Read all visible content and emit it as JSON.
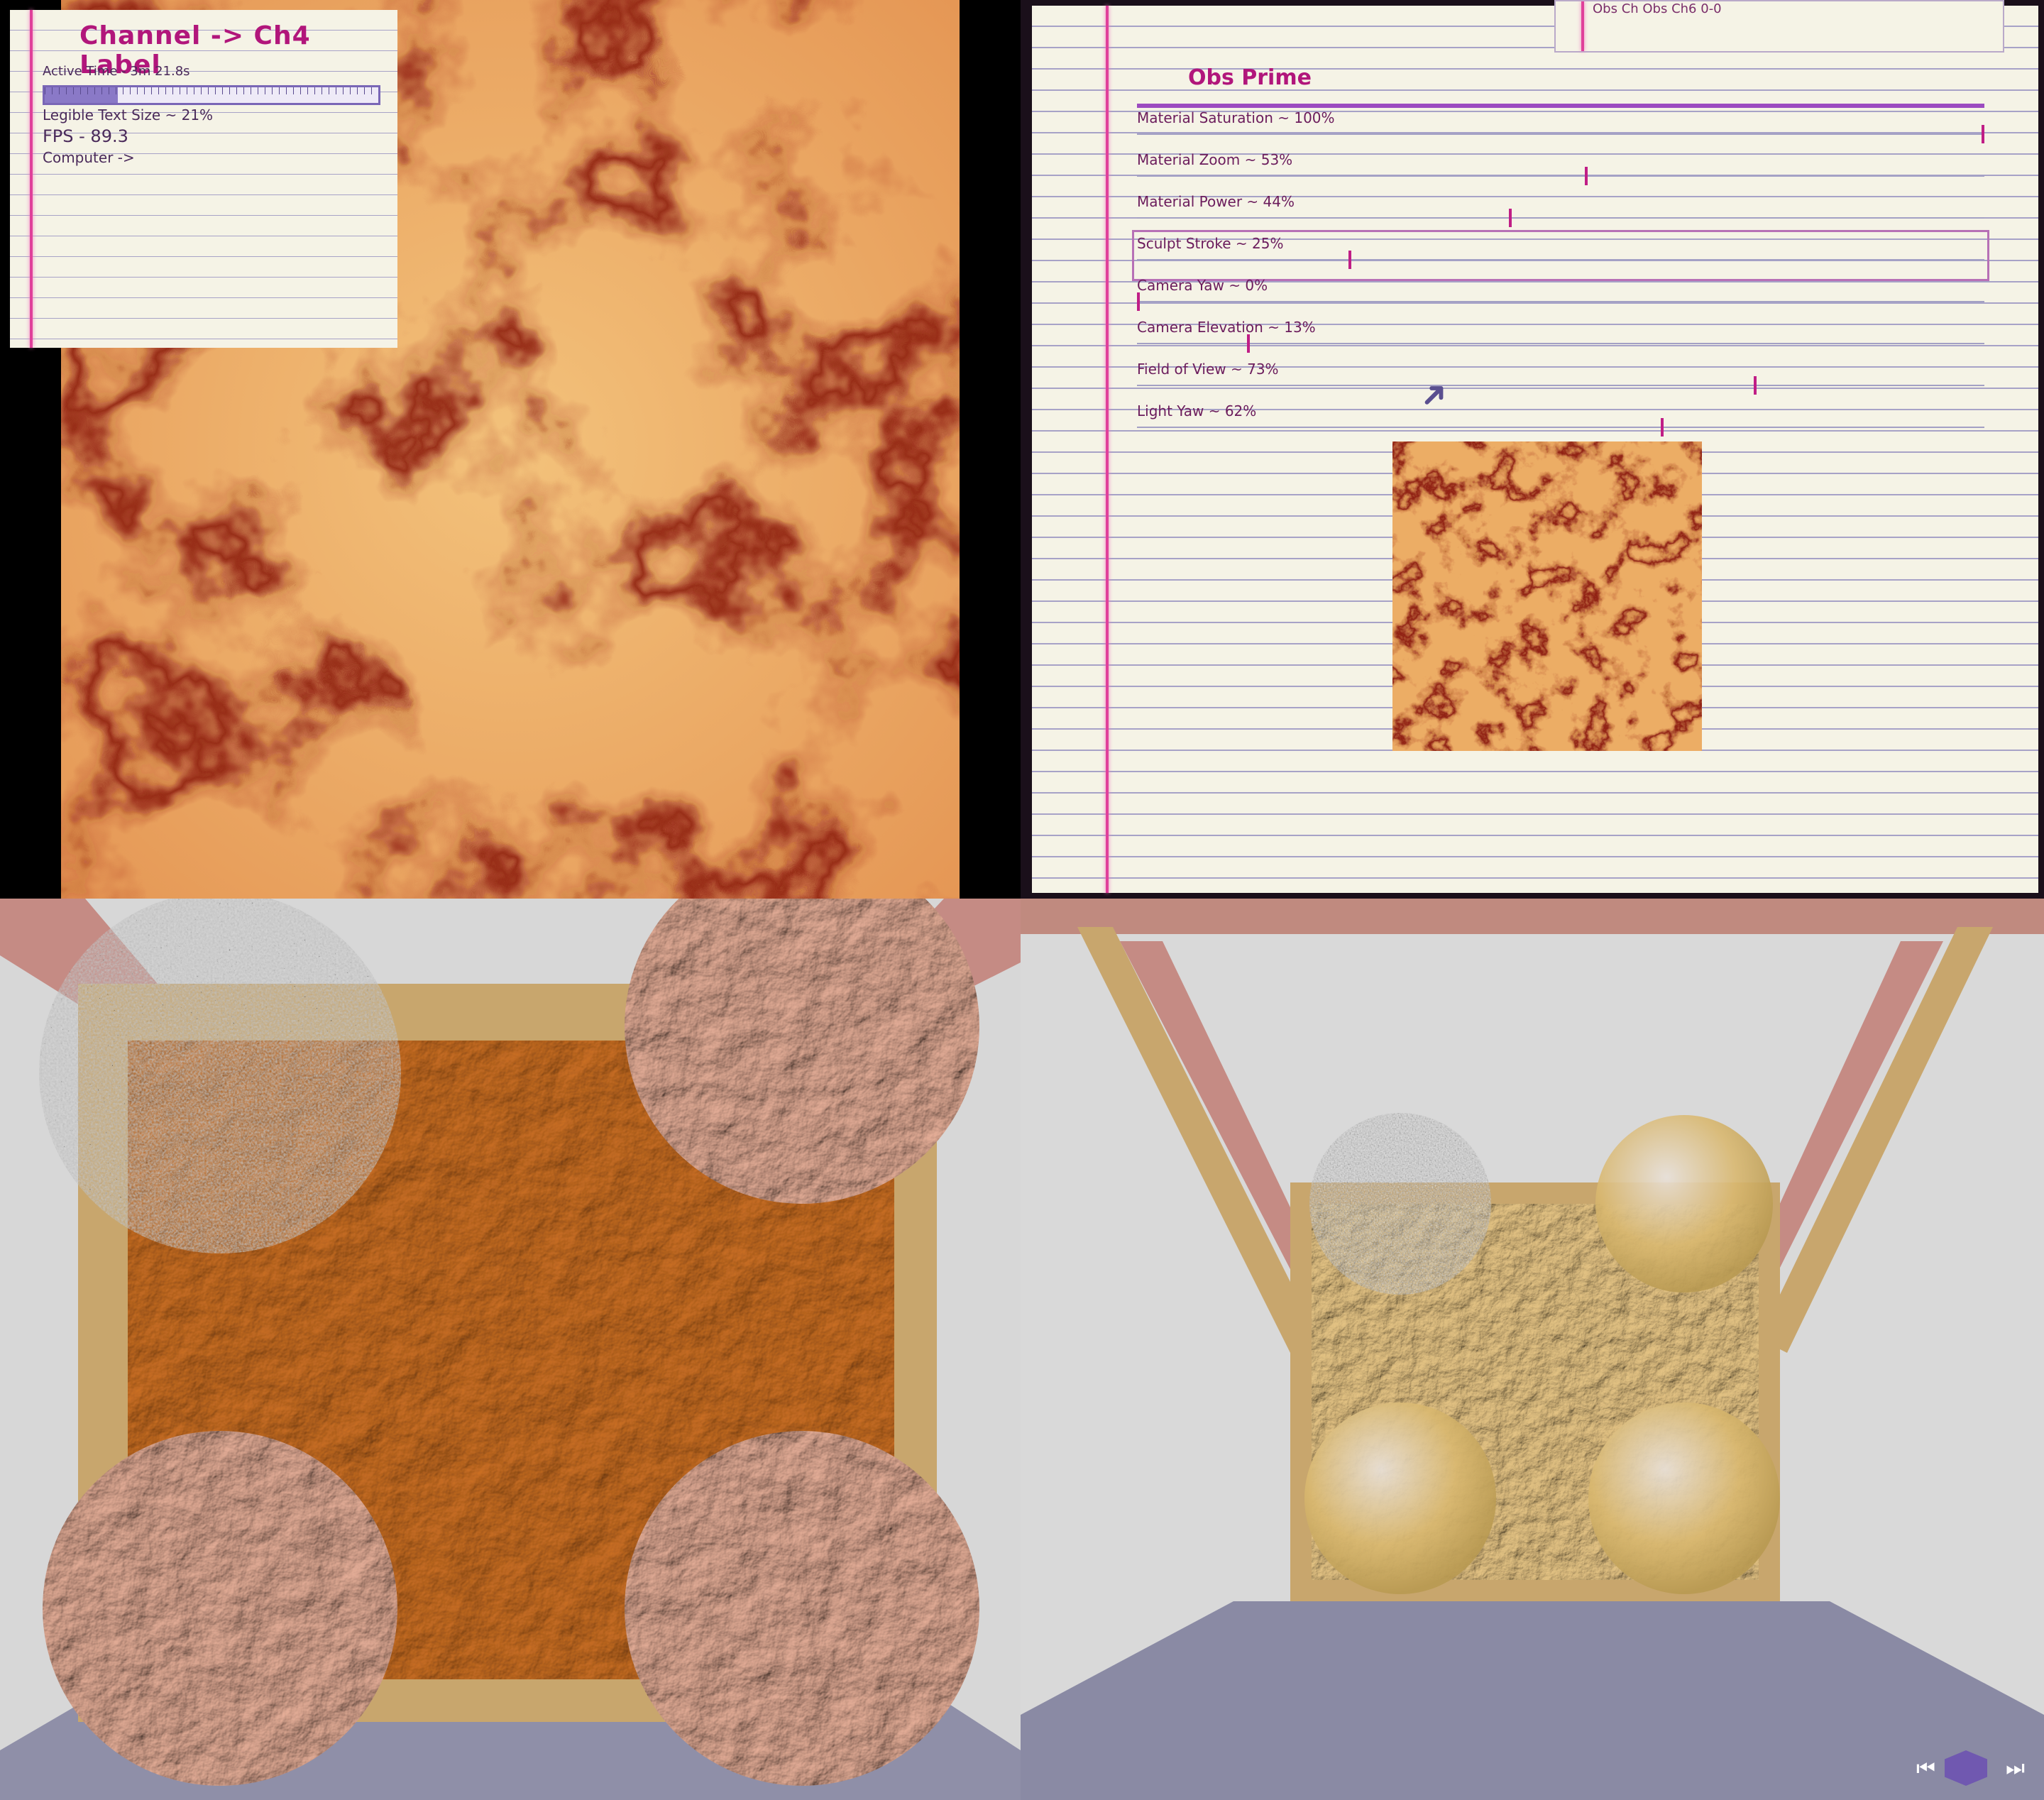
{
  "overlay": {
    "title": "Channel -> Ch4 Label",
    "active_time": "Active Time - 3m 21.8s",
    "legible_text": "Legible Text Size ~ 21%",
    "fps": "FPS - 89.3",
    "computer": "Computer ->"
  },
  "panel": {
    "tab_text": "Obs Ch Obs Ch6 0-0",
    "heading": "Obs Prime",
    "sliders": [
      {
        "label": "Material Saturation ~ 100%",
        "value": 100
      },
      {
        "label": "Material Zoom ~ 53%",
        "value": 53
      },
      {
        "label": "Material Power ~ 44%",
        "value": 44
      },
      {
        "label": "Sculpt Stroke ~ 25%",
        "value": 25,
        "active": true
      },
      {
        "label": "Camera Yaw ~ 0%",
        "value": 0
      },
      {
        "label": "Camera Elevation ~ 13%",
        "value": 13
      },
      {
        "label": "Field of View ~ 73%",
        "value": 73
      },
      {
        "label": "Light Yaw ~ 62%",
        "value": 62
      }
    ]
  },
  "playback": {
    "prev_icon": "skip-back-icon",
    "next_icon": "skip-forward-icon",
    "logo_icon": "cube-logo-icon"
  },
  "colors": {
    "accent": "#b1167b",
    "texture_light": "#f2c07a",
    "texture_dark": "#8e1d10",
    "paper": "#f5f3e6"
  }
}
